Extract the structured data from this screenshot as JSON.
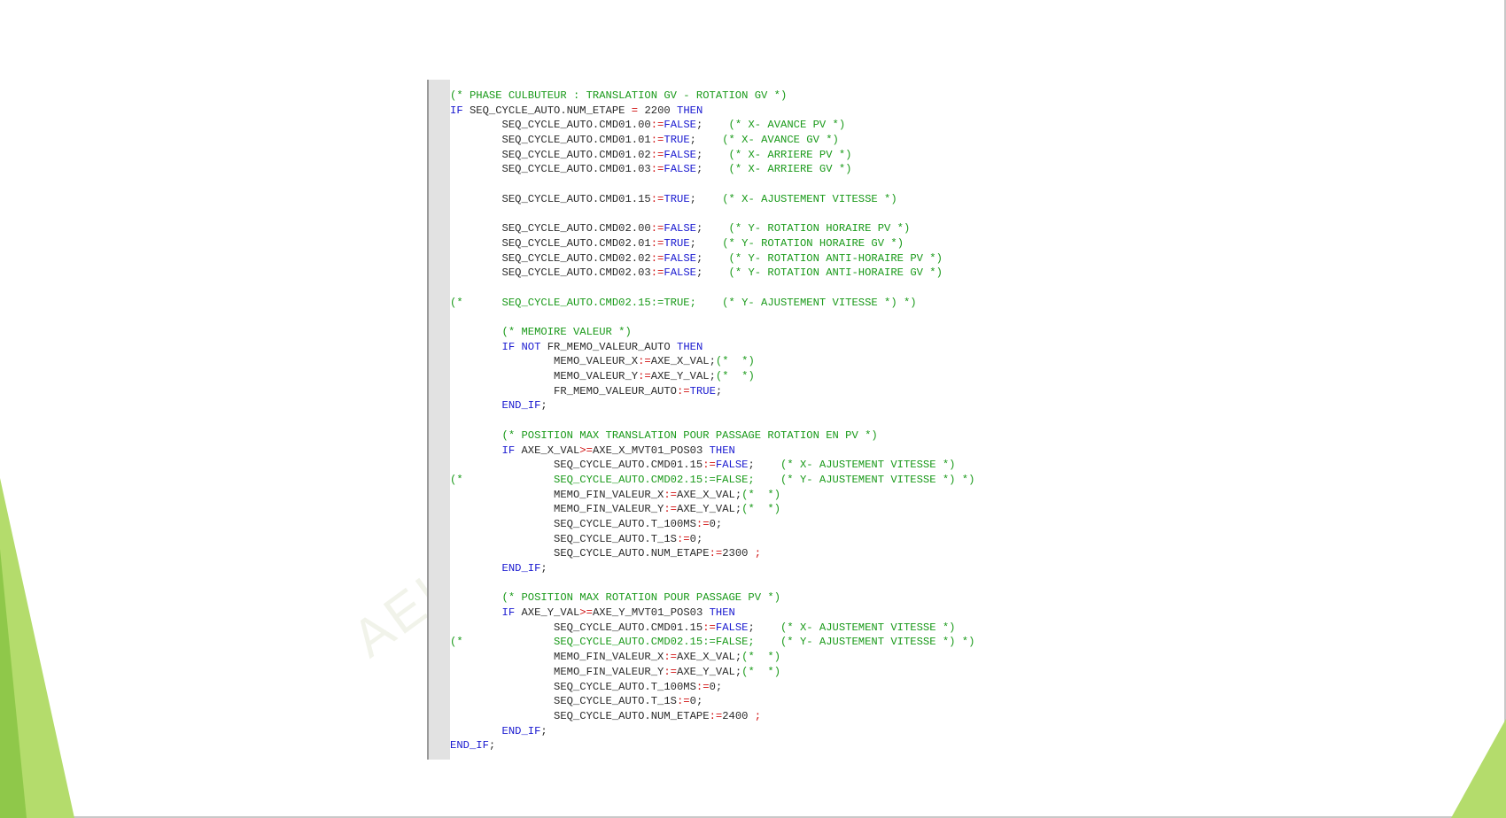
{
  "watermark": "AEI",
  "colors": {
    "keyword": "#1a1ad0",
    "comment": "#1a9a1a",
    "operator": "#d01010",
    "identifier": "#2b2b2b",
    "accent": "#b4dc6c"
  },
  "code_lines": [
    [
      {
        "t": "(* PHASE CULBUTEUR : TRANSLATION GV - ROTATION GV *)",
        "c": "cm"
      }
    ],
    [
      {
        "t": "IF",
        "c": "kw"
      },
      {
        "t": " SEQ_CYCLE_AUTO.NUM_ETAPE "
      },
      {
        "t": "=",
        "c": "op"
      },
      {
        "t": " 2200 "
      },
      {
        "t": "THEN",
        "c": "kw"
      }
    ],
    [
      {
        "t": "        SEQ_CYCLE_AUTO.CMD01.00"
      },
      {
        "t": ":=",
        "c": "op"
      },
      {
        "t": "FALSE",
        "c": "kw"
      },
      {
        "t": ";    "
      },
      {
        "t": "(* X- AVANCE PV *)",
        "c": "cm"
      }
    ],
    [
      {
        "t": "        SEQ_CYCLE_AUTO.CMD01.01"
      },
      {
        "t": ":=",
        "c": "op"
      },
      {
        "t": "TRUE",
        "c": "kw"
      },
      {
        "t": ";    "
      },
      {
        "t": "(* X- AVANCE GV *)",
        "c": "cm"
      }
    ],
    [
      {
        "t": "        SEQ_CYCLE_AUTO.CMD01.02"
      },
      {
        "t": ":=",
        "c": "op"
      },
      {
        "t": "FALSE",
        "c": "kw"
      },
      {
        "t": ";    "
      },
      {
        "t": "(* X- ARRIERE PV *)",
        "c": "cm"
      }
    ],
    [
      {
        "t": "        SEQ_CYCLE_AUTO.CMD01.03"
      },
      {
        "t": ":=",
        "c": "op"
      },
      {
        "t": "FALSE",
        "c": "kw"
      },
      {
        "t": ";    "
      },
      {
        "t": "(* X- ARRIERE GV *)",
        "c": "cm"
      }
    ],
    [
      {
        "t": ""
      }
    ],
    [
      {
        "t": "        SEQ_CYCLE_AUTO.CMD01.15"
      },
      {
        "t": ":=",
        "c": "op"
      },
      {
        "t": "TRUE",
        "c": "kw"
      },
      {
        "t": ";    "
      },
      {
        "t": "(* X- AJUSTEMENT VITESSE *)",
        "c": "cm"
      }
    ],
    [
      {
        "t": ""
      }
    ],
    [
      {
        "t": "        SEQ_CYCLE_AUTO.CMD02.00"
      },
      {
        "t": ":=",
        "c": "op"
      },
      {
        "t": "FALSE",
        "c": "kw"
      },
      {
        "t": ";    "
      },
      {
        "t": "(* Y- ROTATION HORAIRE PV *)",
        "c": "cm"
      }
    ],
    [
      {
        "t": "        SEQ_CYCLE_AUTO.CMD02.01"
      },
      {
        "t": ":=",
        "c": "op"
      },
      {
        "t": "TRUE",
        "c": "kw"
      },
      {
        "t": ";    "
      },
      {
        "t": "(* Y- ROTATION HORAIRE GV *)",
        "c": "cm"
      }
    ],
    [
      {
        "t": "        SEQ_CYCLE_AUTO.CMD02.02"
      },
      {
        "t": ":=",
        "c": "op"
      },
      {
        "t": "FALSE",
        "c": "kw"
      },
      {
        "t": ";    "
      },
      {
        "t": "(* Y- ROTATION ANTI-HORAIRE PV *)",
        "c": "cm"
      }
    ],
    [
      {
        "t": "        SEQ_CYCLE_AUTO.CMD02.03"
      },
      {
        "t": ":=",
        "c": "op"
      },
      {
        "t": "FALSE",
        "c": "kw"
      },
      {
        "t": ";    "
      },
      {
        "t": "(* Y- ROTATION ANTI-HORAIRE GV *)",
        "c": "cm"
      }
    ],
    [
      {
        "t": ""
      }
    ],
    [
      {
        "t": "(*      SEQ_CYCLE_AUTO.CMD02.15:=TRUE;    (* Y- AJUSTEMENT VITESSE *) *)",
        "c": "cm"
      }
    ],
    [
      {
        "t": ""
      }
    ],
    [
      {
        "t": "        "
      },
      {
        "t": "(* MEMOIRE VALEUR *)",
        "c": "cm"
      }
    ],
    [
      {
        "t": "        "
      },
      {
        "t": "IF NOT",
        "c": "kw"
      },
      {
        "t": " FR_MEMO_VALEUR_AUTO "
      },
      {
        "t": "THEN",
        "c": "kw"
      }
    ],
    [
      {
        "t": "                MEMO_VALEUR_X"
      },
      {
        "t": ":=",
        "c": "op"
      },
      {
        "t": "AXE_X_VAL;"
      },
      {
        "t": "(*  *)",
        "c": "cm"
      }
    ],
    [
      {
        "t": "                MEMO_VALEUR_Y"
      },
      {
        "t": ":=",
        "c": "op"
      },
      {
        "t": "AXE_Y_VAL;"
      },
      {
        "t": "(*  *)",
        "c": "cm"
      }
    ],
    [
      {
        "t": "                FR_MEMO_VALEUR_AUTO"
      },
      {
        "t": ":=",
        "c": "op"
      },
      {
        "t": "TRUE",
        "c": "kw"
      },
      {
        "t": ";"
      }
    ],
    [
      {
        "t": "        "
      },
      {
        "t": "END_IF",
        "c": "kw"
      },
      {
        "t": ";"
      }
    ],
    [
      {
        "t": ""
      }
    ],
    [
      {
        "t": "        "
      },
      {
        "t": "(* POSITION MAX TRANSLATION POUR PASSAGE ROTATION EN PV *)",
        "c": "cm"
      }
    ],
    [
      {
        "t": "        "
      },
      {
        "t": "IF",
        "c": "kw"
      },
      {
        "t": " AXE_X_VAL"
      },
      {
        "t": ">=",
        "c": "op"
      },
      {
        "t": "AXE_X_MVT01_POS03 "
      },
      {
        "t": "THEN",
        "c": "kw"
      }
    ],
    [
      {
        "t": "                SEQ_CYCLE_AUTO.CMD01.15"
      },
      {
        "t": ":=",
        "c": "op"
      },
      {
        "t": "FALSE",
        "c": "kw"
      },
      {
        "t": ";    "
      },
      {
        "t": "(* X- AJUSTEMENT VITESSE *)",
        "c": "cm"
      }
    ],
    [
      {
        "t": "(*              SEQ_CYCLE_AUTO.CMD02.15:=FALSE;    (* Y- AJUSTEMENT VITESSE *) *)",
        "c": "cm"
      }
    ],
    [
      {
        "t": "                MEMO_FIN_VALEUR_X"
      },
      {
        "t": ":=",
        "c": "op"
      },
      {
        "t": "AXE_X_VAL;"
      },
      {
        "t": "(*  *)",
        "c": "cm"
      }
    ],
    [
      {
        "t": "                MEMO_FIN_VALEUR_Y"
      },
      {
        "t": ":=",
        "c": "op"
      },
      {
        "t": "AXE_Y_VAL;"
      },
      {
        "t": "(*  *)",
        "c": "cm"
      }
    ],
    [
      {
        "t": "                SEQ_CYCLE_AUTO.T_100MS"
      },
      {
        "t": ":=",
        "c": "op"
      },
      {
        "t": "0;"
      }
    ],
    [
      {
        "t": "                SEQ_CYCLE_AUTO.T_1S"
      },
      {
        "t": ":=",
        "c": "op"
      },
      {
        "t": "0;"
      }
    ],
    [
      {
        "t": "                SEQ_CYCLE_AUTO.NUM_ETAPE"
      },
      {
        "t": ":=",
        "c": "op"
      },
      {
        "t": "2300 "
      },
      {
        "t": ";",
        "c": "op"
      }
    ],
    [
      {
        "t": "        "
      },
      {
        "t": "END_IF",
        "c": "kw"
      },
      {
        "t": ";"
      }
    ],
    [
      {
        "t": ""
      }
    ],
    [
      {
        "t": "        "
      },
      {
        "t": "(* POSITION MAX ROTATION POUR PASSAGE PV *)",
        "c": "cm"
      }
    ],
    [
      {
        "t": "        "
      },
      {
        "t": "IF",
        "c": "kw"
      },
      {
        "t": " AXE_Y_VAL"
      },
      {
        "t": ">=",
        "c": "op"
      },
      {
        "t": "AXE_Y_MVT01_POS03 "
      },
      {
        "t": "THEN",
        "c": "kw"
      }
    ],
    [
      {
        "t": "                SEQ_CYCLE_AUTO.CMD01.15"
      },
      {
        "t": ":=",
        "c": "op"
      },
      {
        "t": "FALSE",
        "c": "kw"
      },
      {
        "t": ";    "
      },
      {
        "t": "(* X- AJUSTEMENT VITESSE *)",
        "c": "cm"
      }
    ],
    [
      {
        "t": "(*              SEQ_CYCLE_AUTO.CMD02.15:=FALSE;    (* Y- AJUSTEMENT VITESSE *) *)",
        "c": "cm"
      }
    ],
    [
      {
        "t": "                MEMO_FIN_VALEUR_X"
      },
      {
        "t": ":=",
        "c": "op"
      },
      {
        "t": "AXE_X_VAL;"
      },
      {
        "t": "(*  *)",
        "c": "cm"
      }
    ],
    [
      {
        "t": "                MEMO_FIN_VALEUR_Y"
      },
      {
        "t": ":=",
        "c": "op"
      },
      {
        "t": "AXE_Y_VAL;"
      },
      {
        "t": "(*  *)",
        "c": "cm"
      }
    ],
    [
      {
        "t": "                SEQ_CYCLE_AUTO.T_100MS"
      },
      {
        "t": ":=",
        "c": "op"
      },
      {
        "t": "0;"
      }
    ],
    [
      {
        "t": "                SEQ_CYCLE_AUTO.T_1S"
      },
      {
        "t": ":=",
        "c": "op"
      },
      {
        "t": "0;"
      }
    ],
    [
      {
        "t": "                SEQ_CYCLE_AUTO.NUM_ETAPE"
      },
      {
        "t": ":=",
        "c": "op"
      },
      {
        "t": "2400 "
      },
      {
        "t": ";",
        "c": "op"
      }
    ],
    [
      {
        "t": "        "
      },
      {
        "t": "END_IF",
        "c": "kw"
      },
      {
        "t": ";"
      }
    ],
    [
      {
        "t": "END_IF",
        "c": "kw"
      },
      {
        "t": ";"
      }
    ]
  ]
}
